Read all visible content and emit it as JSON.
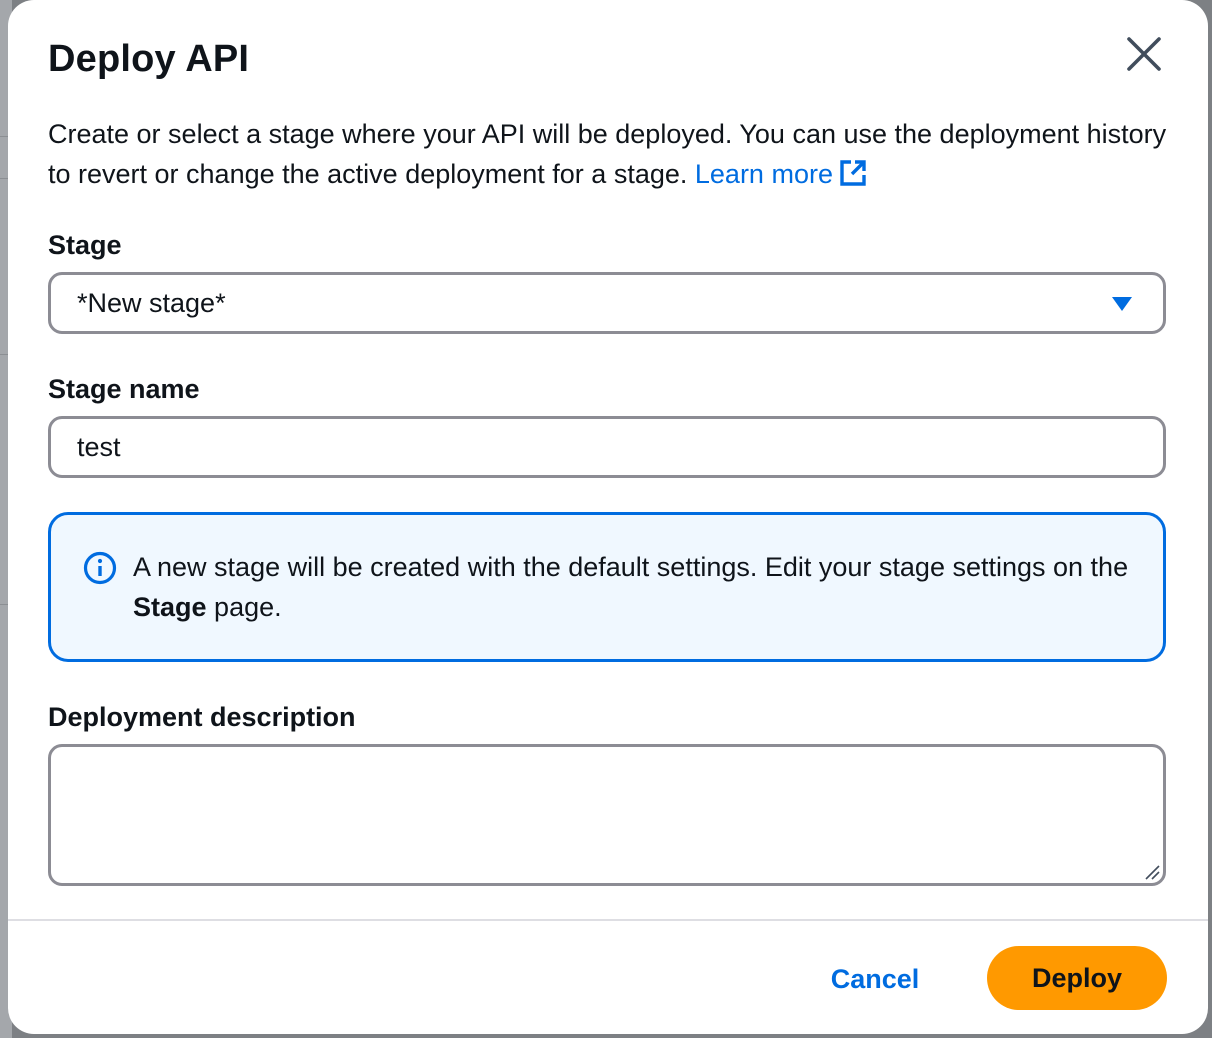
{
  "modal": {
    "title": "Deploy API",
    "close_icon": "close-icon",
    "intro_text": "Create or select a stage where your API will be deployed. You can use the deployment history to revert or change the active deployment for a stage.",
    "learn_more_label": "Learn more",
    "learn_more_icon": "external-link-icon"
  },
  "stage": {
    "label": "Stage",
    "selected_value": "*New stage*",
    "caret_icon": "caret-down-icon"
  },
  "stage_name": {
    "label": "Stage name",
    "value": "test"
  },
  "info_alert": {
    "icon": "info-icon",
    "text_before": "A new stage will be created with the default settings. Edit your stage settings on the",
    "bold_text": "Stage",
    "text_after": "page."
  },
  "deployment_description": {
    "label": "Deployment description",
    "value": ""
  },
  "footer": {
    "cancel_label": "Cancel",
    "deploy_label": "Deploy"
  },
  "colors": {
    "link": "#006ce0",
    "primary_button": "#ff9900",
    "alert_border": "#006ce0",
    "alert_background": "#f0f8ff",
    "input_border": "#8c8c94"
  }
}
